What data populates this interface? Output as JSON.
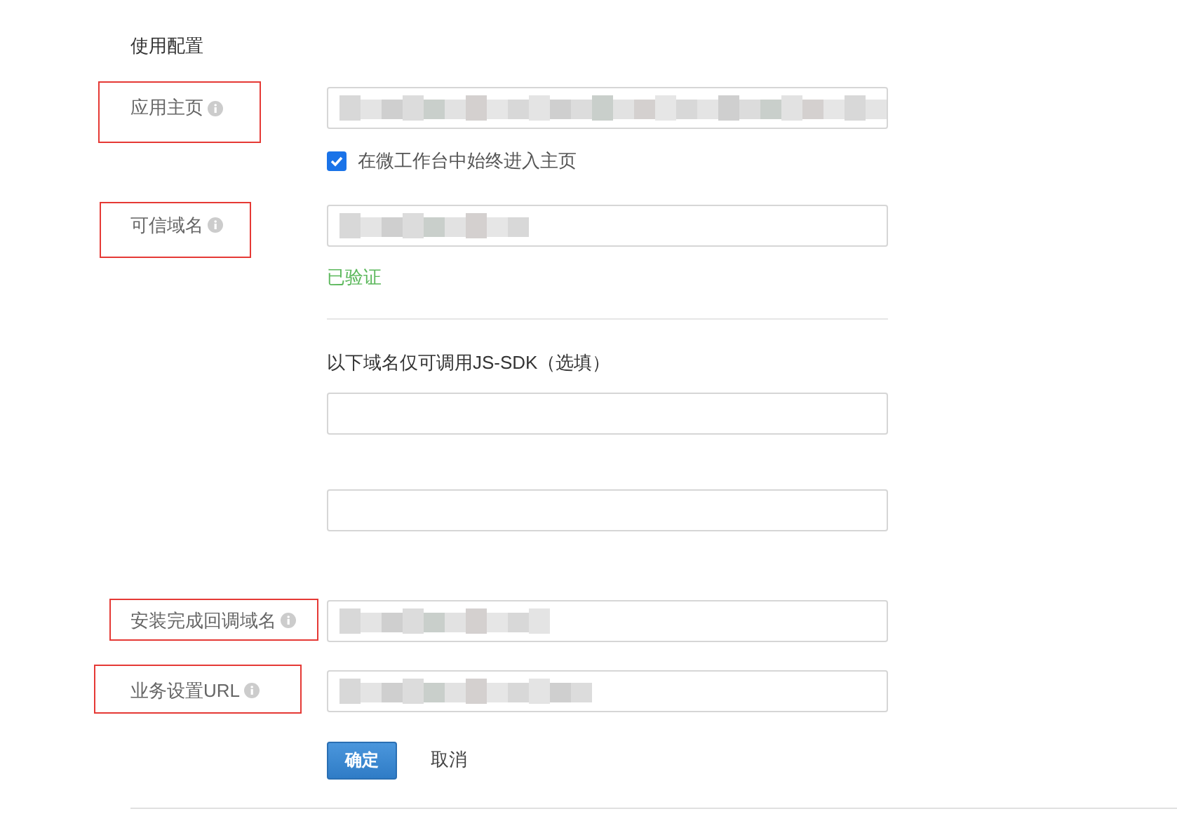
{
  "section_title": "使用配置",
  "main_fields": [
    {
      "label": "应用主页",
      "info": true,
      "highlighted": true,
      "redacted": true,
      "checkbox": {
        "label": "在微工作台中始终进入主页",
        "checked": true
      }
    },
    {
      "label": "可信域名",
      "info": true,
      "highlighted": true,
      "redacted": true,
      "status": "已验证"
    }
  ],
  "jssdk": {
    "title": "以下域名仅可调用JS-SDK（选填）",
    "fields": [
      {
        "redacted": false
      },
      {
        "redacted": false
      }
    ]
  },
  "extra_fields": [
    {
      "label": "安装完成回调域名",
      "info": true,
      "highlighted": true,
      "redacted": true
    },
    {
      "label": "业务设置URL",
      "info": true,
      "highlighted": true,
      "redacted": true
    }
  ],
  "buttons": [
    {
      "kind": "primary",
      "label": "确定"
    },
    {
      "kind": "plain",
      "label": "取消"
    }
  ]
}
